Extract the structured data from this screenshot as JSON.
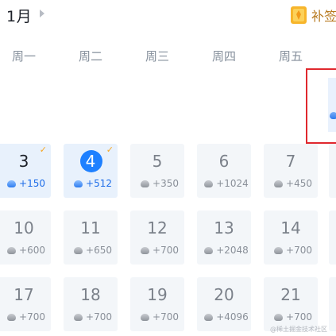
{
  "header": {
    "month": "1月",
    "supplement_label": "补签",
    "supplement_icon": "card-icon"
  },
  "weekdays": [
    "周一",
    "周二",
    "周三",
    "周四",
    "周五"
  ],
  "colors": {
    "accent": "#1e80ff",
    "check": "#f5a623",
    "highlight_border": "#e0282e"
  },
  "rows": [
    [
      {
        "day": "3",
        "reward": "+150",
        "state": "claimed",
        "checked": true
      },
      {
        "day": "4",
        "reward": "+512",
        "state": "today",
        "checked": true
      },
      {
        "day": "5",
        "reward": "+350",
        "state": "future",
        "checked": false
      },
      {
        "day": "6",
        "reward": "+1024",
        "state": "future",
        "checked": false
      },
      {
        "day": "7",
        "reward": "+450",
        "state": "future",
        "checked": false
      }
    ],
    [
      {
        "day": "10",
        "reward": "+600",
        "state": "future",
        "checked": false
      },
      {
        "day": "11",
        "reward": "+650",
        "state": "future",
        "checked": false
      },
      {
        "day": "12",
        "reward": "+700",
        "state": "future",
        "checked": false
      },
      {
        "day": "13",
        "reward": "+2048",
        "state": "future",
        "checked": false
      },
      {
        "day": "14",
        "reward": "+700",
        "state": "future",
        "checked": false
      }
    ],
    [
      {
        "day": "17",
        "reward": "+700",
        "state": "future",
        "checked": false
      },
      {
        "day": "18",
        "reward": "+700",
        "state": "future",
        "checked": false
      },
      {
        "day": "19",
        "reward": "+700",
        "state": "future",
        "checked": false
      },
      {
        "day": "20",
        "reward": "+4096",
        "state": "future",
        "checked": false
      },
      {
        "day": "21",
        "reward": "+700",
        "state": "future",
        "checked": false
      }
    ]
  ],
  "watermark": "@稀土掘金技术社区"
}
